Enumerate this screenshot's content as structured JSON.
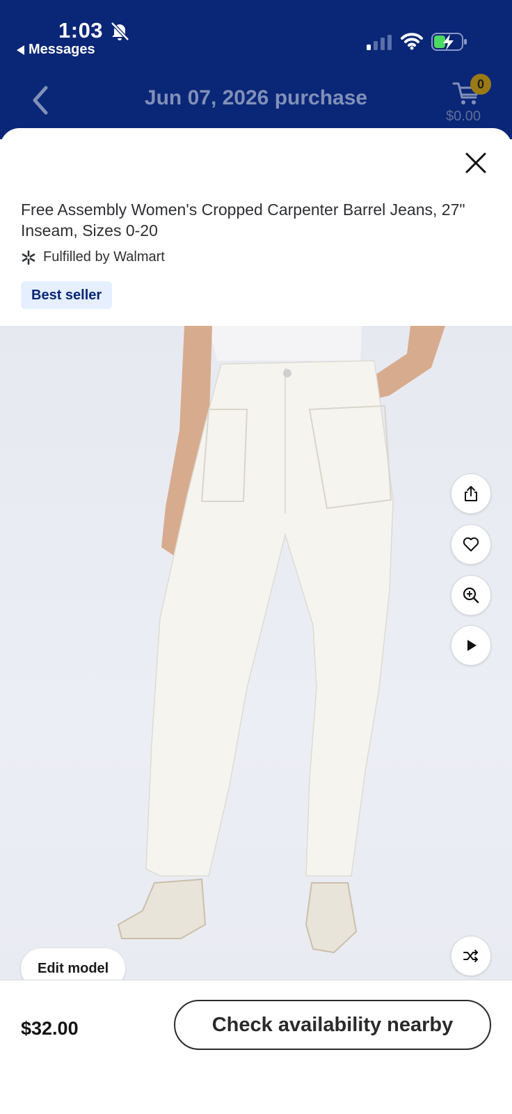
{
  "status_bar": {
    "time": "1:03",
    "back_app": "Messages"
  },
  "nav": {
    "title": "Jun 07, 2026 purchase",
    "cart_count": "0",
    "cart_total": "$0.00"
  },
  "product": {
    "title": "Free Assembly Women's Cropped Carpenter Barrel Jeans, 27\" Inseam, Sizes 0-20",
    "fulfilled": "Fulfilled by Walmart",
    "badge": "Best seller"
  },
  "media": {
    "edit_model": "Edit model"
  },
  "footer": {
    "price": "$32.00",
    "cta": "Check availability nearby"
  },
  "colors": {
    "brand_blue": "#0a2677",
    "badge_bg": "#e6efff",
    "cart_badge": "#9a7a15"
  }
}
